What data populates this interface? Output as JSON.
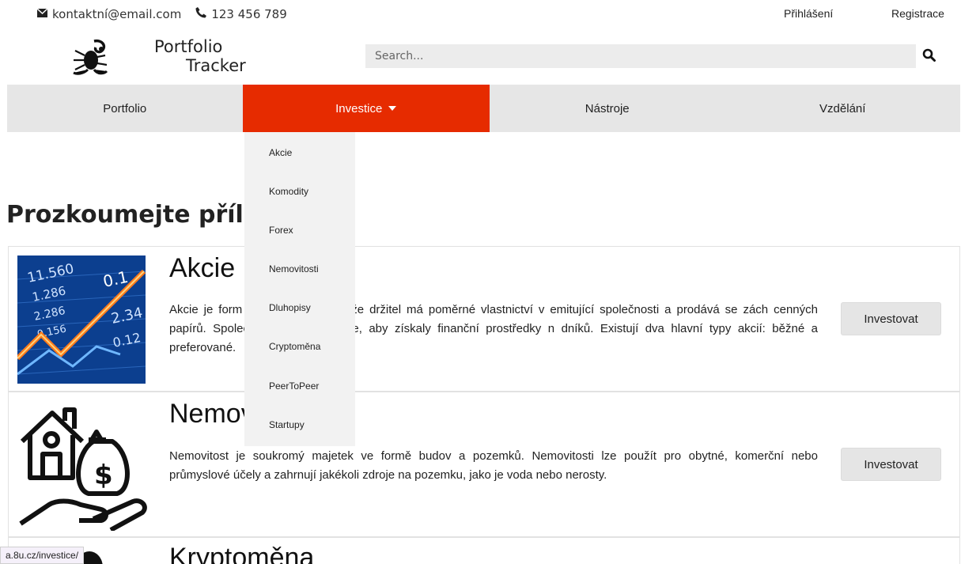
{
  "topbar": {
    "email": "kontaktní@email.com",
    "phone": "123 456 789",
    "login": "Přihlášení",
    "register": "Registrace"
  },
  "logo": {
    "line1": "Portfolio",
    "line2": "Tracker"
  },
  "search": {
    "placeholder": "Search..."
  },
  "nav": {
    "items": [
      {
        "label": "Portfolio"
      },
      {
        "label": "Investice"
      },
      {
        "label": "Nástroje"
      },
      {
        "label": "Vzdělání"
      }
    ]
  },
  "dropdown": {
    "items": [
      "Akcie",
      "Komodity",
      "Forex",
      "Nemovitosti",
      "Dluhopisy",
      "Cryptoměna",
      "PeerToPeer",
      "Startupy"
    ]
  },
  "page": {
    "title": "Prozkoumejte přílež"
  },
  "cards": [
    {
      "title": "Akcie",
      "desc": "Akcie je form             , která naznačuje, že držitel má poměrné vlastnictví v emitující společnosti a prodává se                zách cenných papírů. Společnosti vydávají akcie, aby získaly finanční prostředky n              dníků. Existují dva hlavní typy akcií: běžné a preferované.",
      "button": "Investovat",
      "image_icon": "stock-market-image"
    },
    {
      "title": "Nemov",
      "desc": "Nemovitost je soukromý majetek ve formě budov a pozemků. Nemovitosti lze použít pro obytné, komerční nebo průmyslové účely a zahrnují jakékoli zdroje na pozemku, jako je voda nebo nerosty.",
      "button": "Investovat",
      "image_icon": "house-money-hand-icon"
    },
    {
      "title": "Kryptoměna"
    }
  ],
  "statusbar": {
    "url": "a.8u.cz/investice/"
  },
  "colors": {
    "accent": "#e62b00",
    "nav_bg": "#e6e6e6",
    "dropdown_bg": "#f2f2f2"
  }
}
